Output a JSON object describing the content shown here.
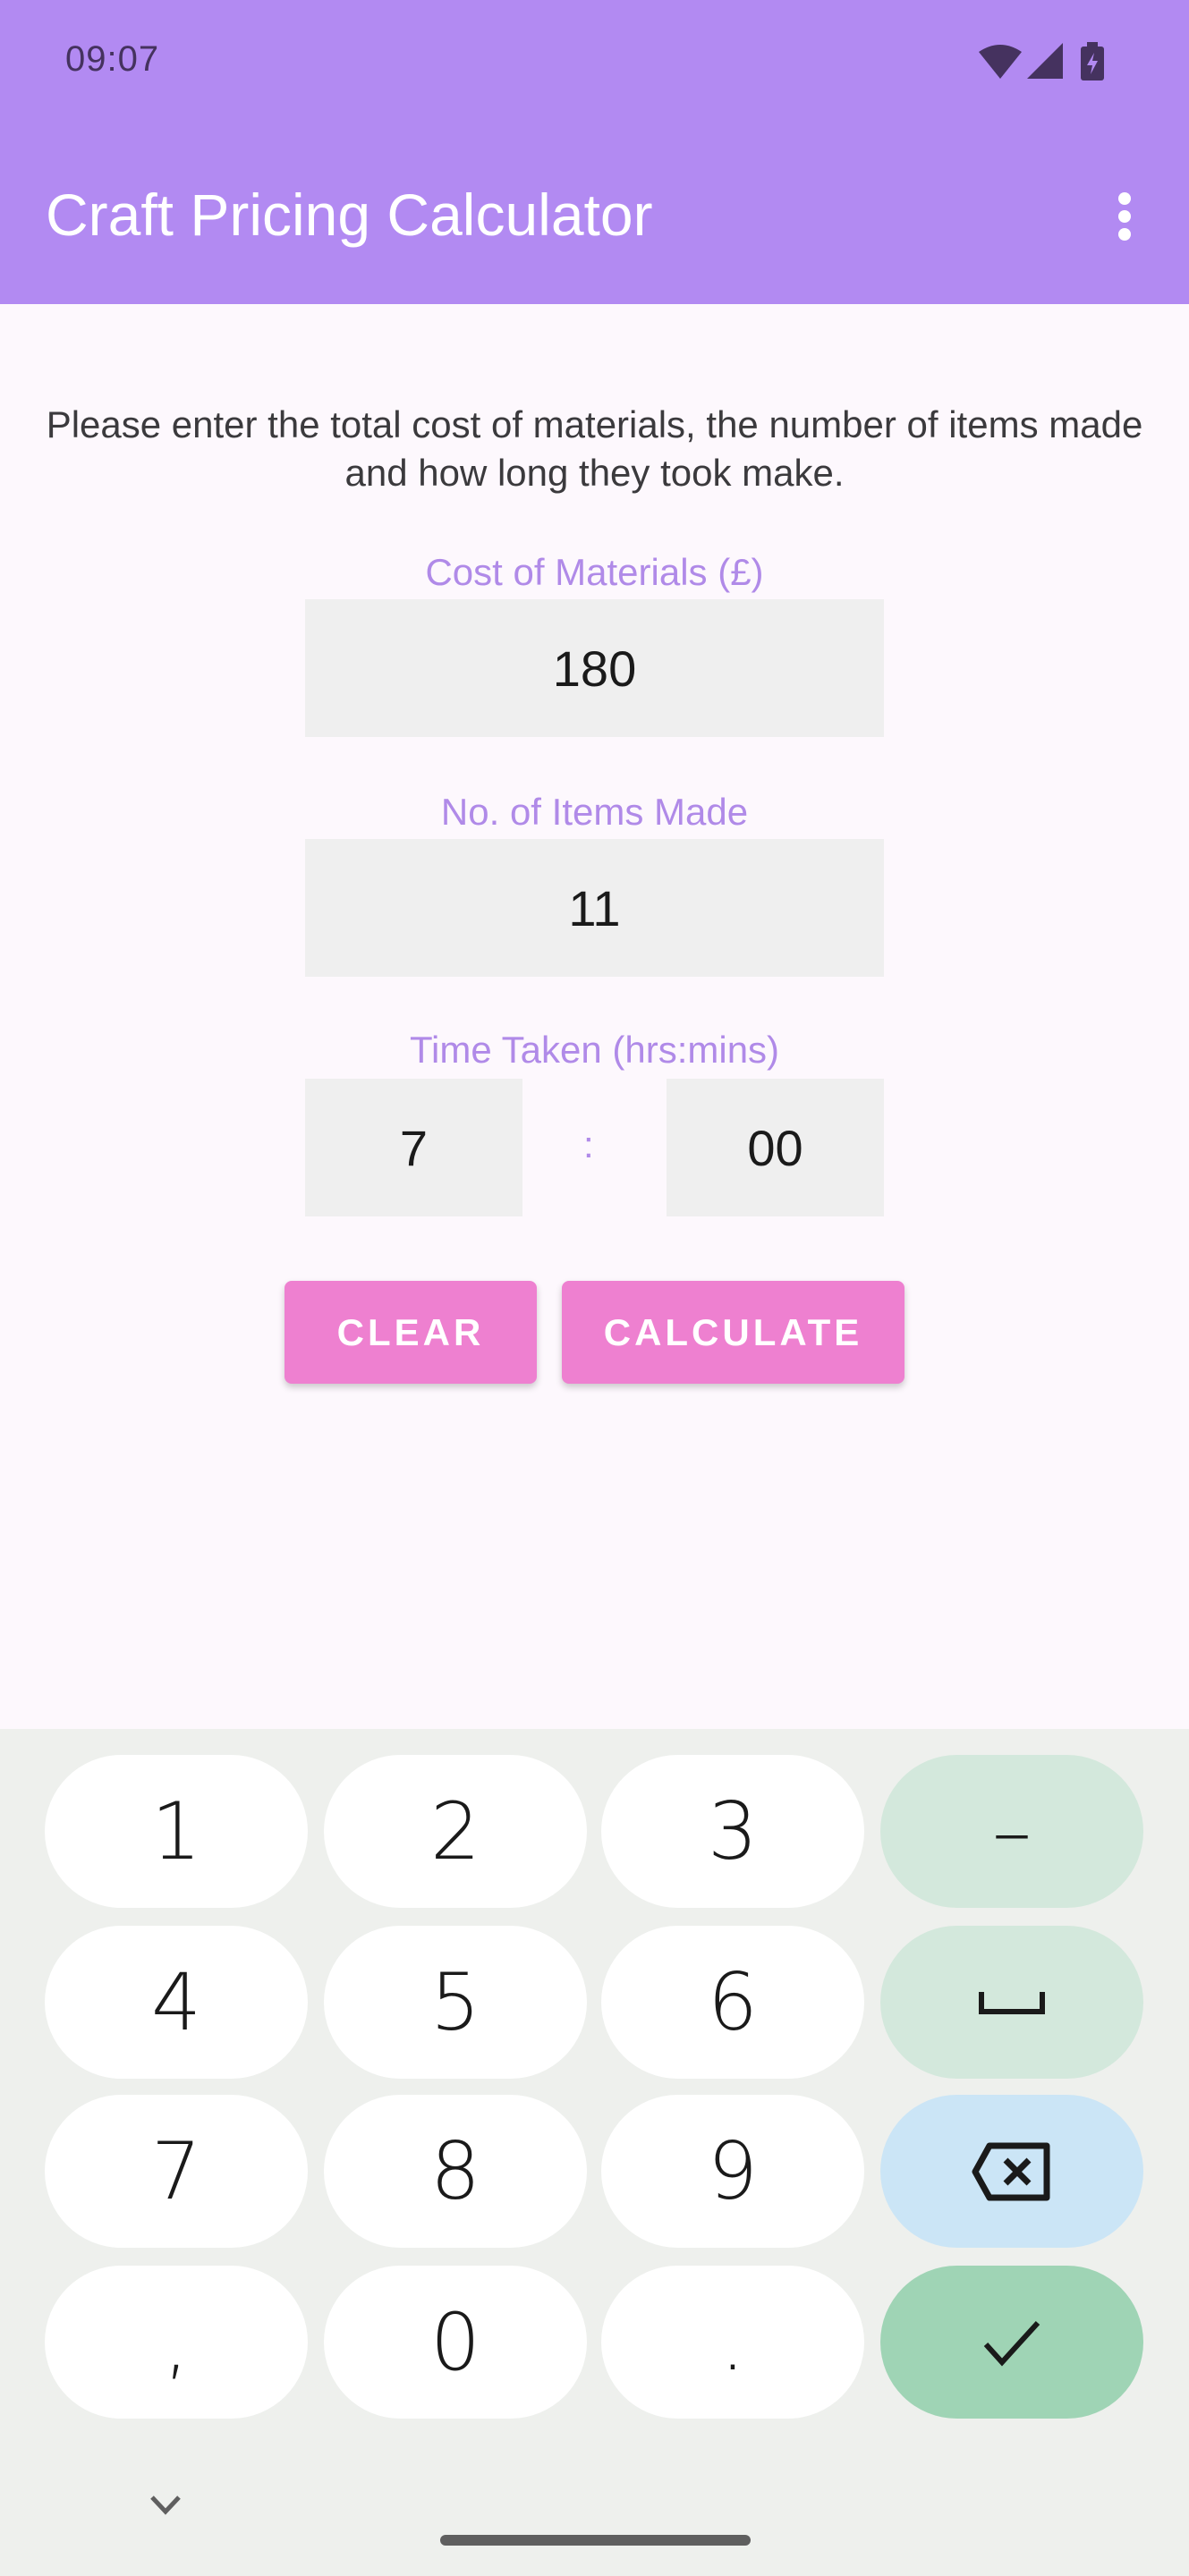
{
  "status_bar": {
    "time": "09:07",
    "icons": [
      "wifi-icon",
      "cellular-signal-icon",
      "battery-charging-icon"
    ]
  },
  "app_bar": {
    "title": "Craft Pricing Calculator",
    "overflow_icon": "more-vert-icon"
  },
  "main": {
    "instructions": "Please enter the total cost of materials, the number of items made and how long they took make.",
    "cost_field": {
      "label": "Cost of Materials (£)",
      "value": "180"
    },
    "items_field": {
      "label": "No. of Items Made",
      "value": "11"
    },
    "time_field": {
      "label": "Time Taken (hrs:mins)",
      "hours_value": "7",
      "separator": ":",
      "minutes_value": "00"
    },
    "buttons": {
      "clear_label": "CLEAR",
      "calculate_label": "CALCULATE"
    }
  },
  "keyboard": {
    "rows": [
      [
        "1",
        "2",
        "3",
        "–"
      ],
      [
        "4",
        "5",
        "6",
        "␣"
      ],
      [
        "7",
        "8",
        "9",
        "backspace"
      ],
      [
        ",",
        "0",
        ".",
        "done"
      ]
    ],
    "hide_icon": "chevron-down-icon"
  },
  "colors": {
    "app_bar": "#b28af2",
    "label_accent": "#b08ae8",
    "button": "#ee80d0",
    "key_function": "#d3e8dc",
    "key_delete": "#cbe5f6",
    "key_enter": "#9fd4b5"
  }
}
